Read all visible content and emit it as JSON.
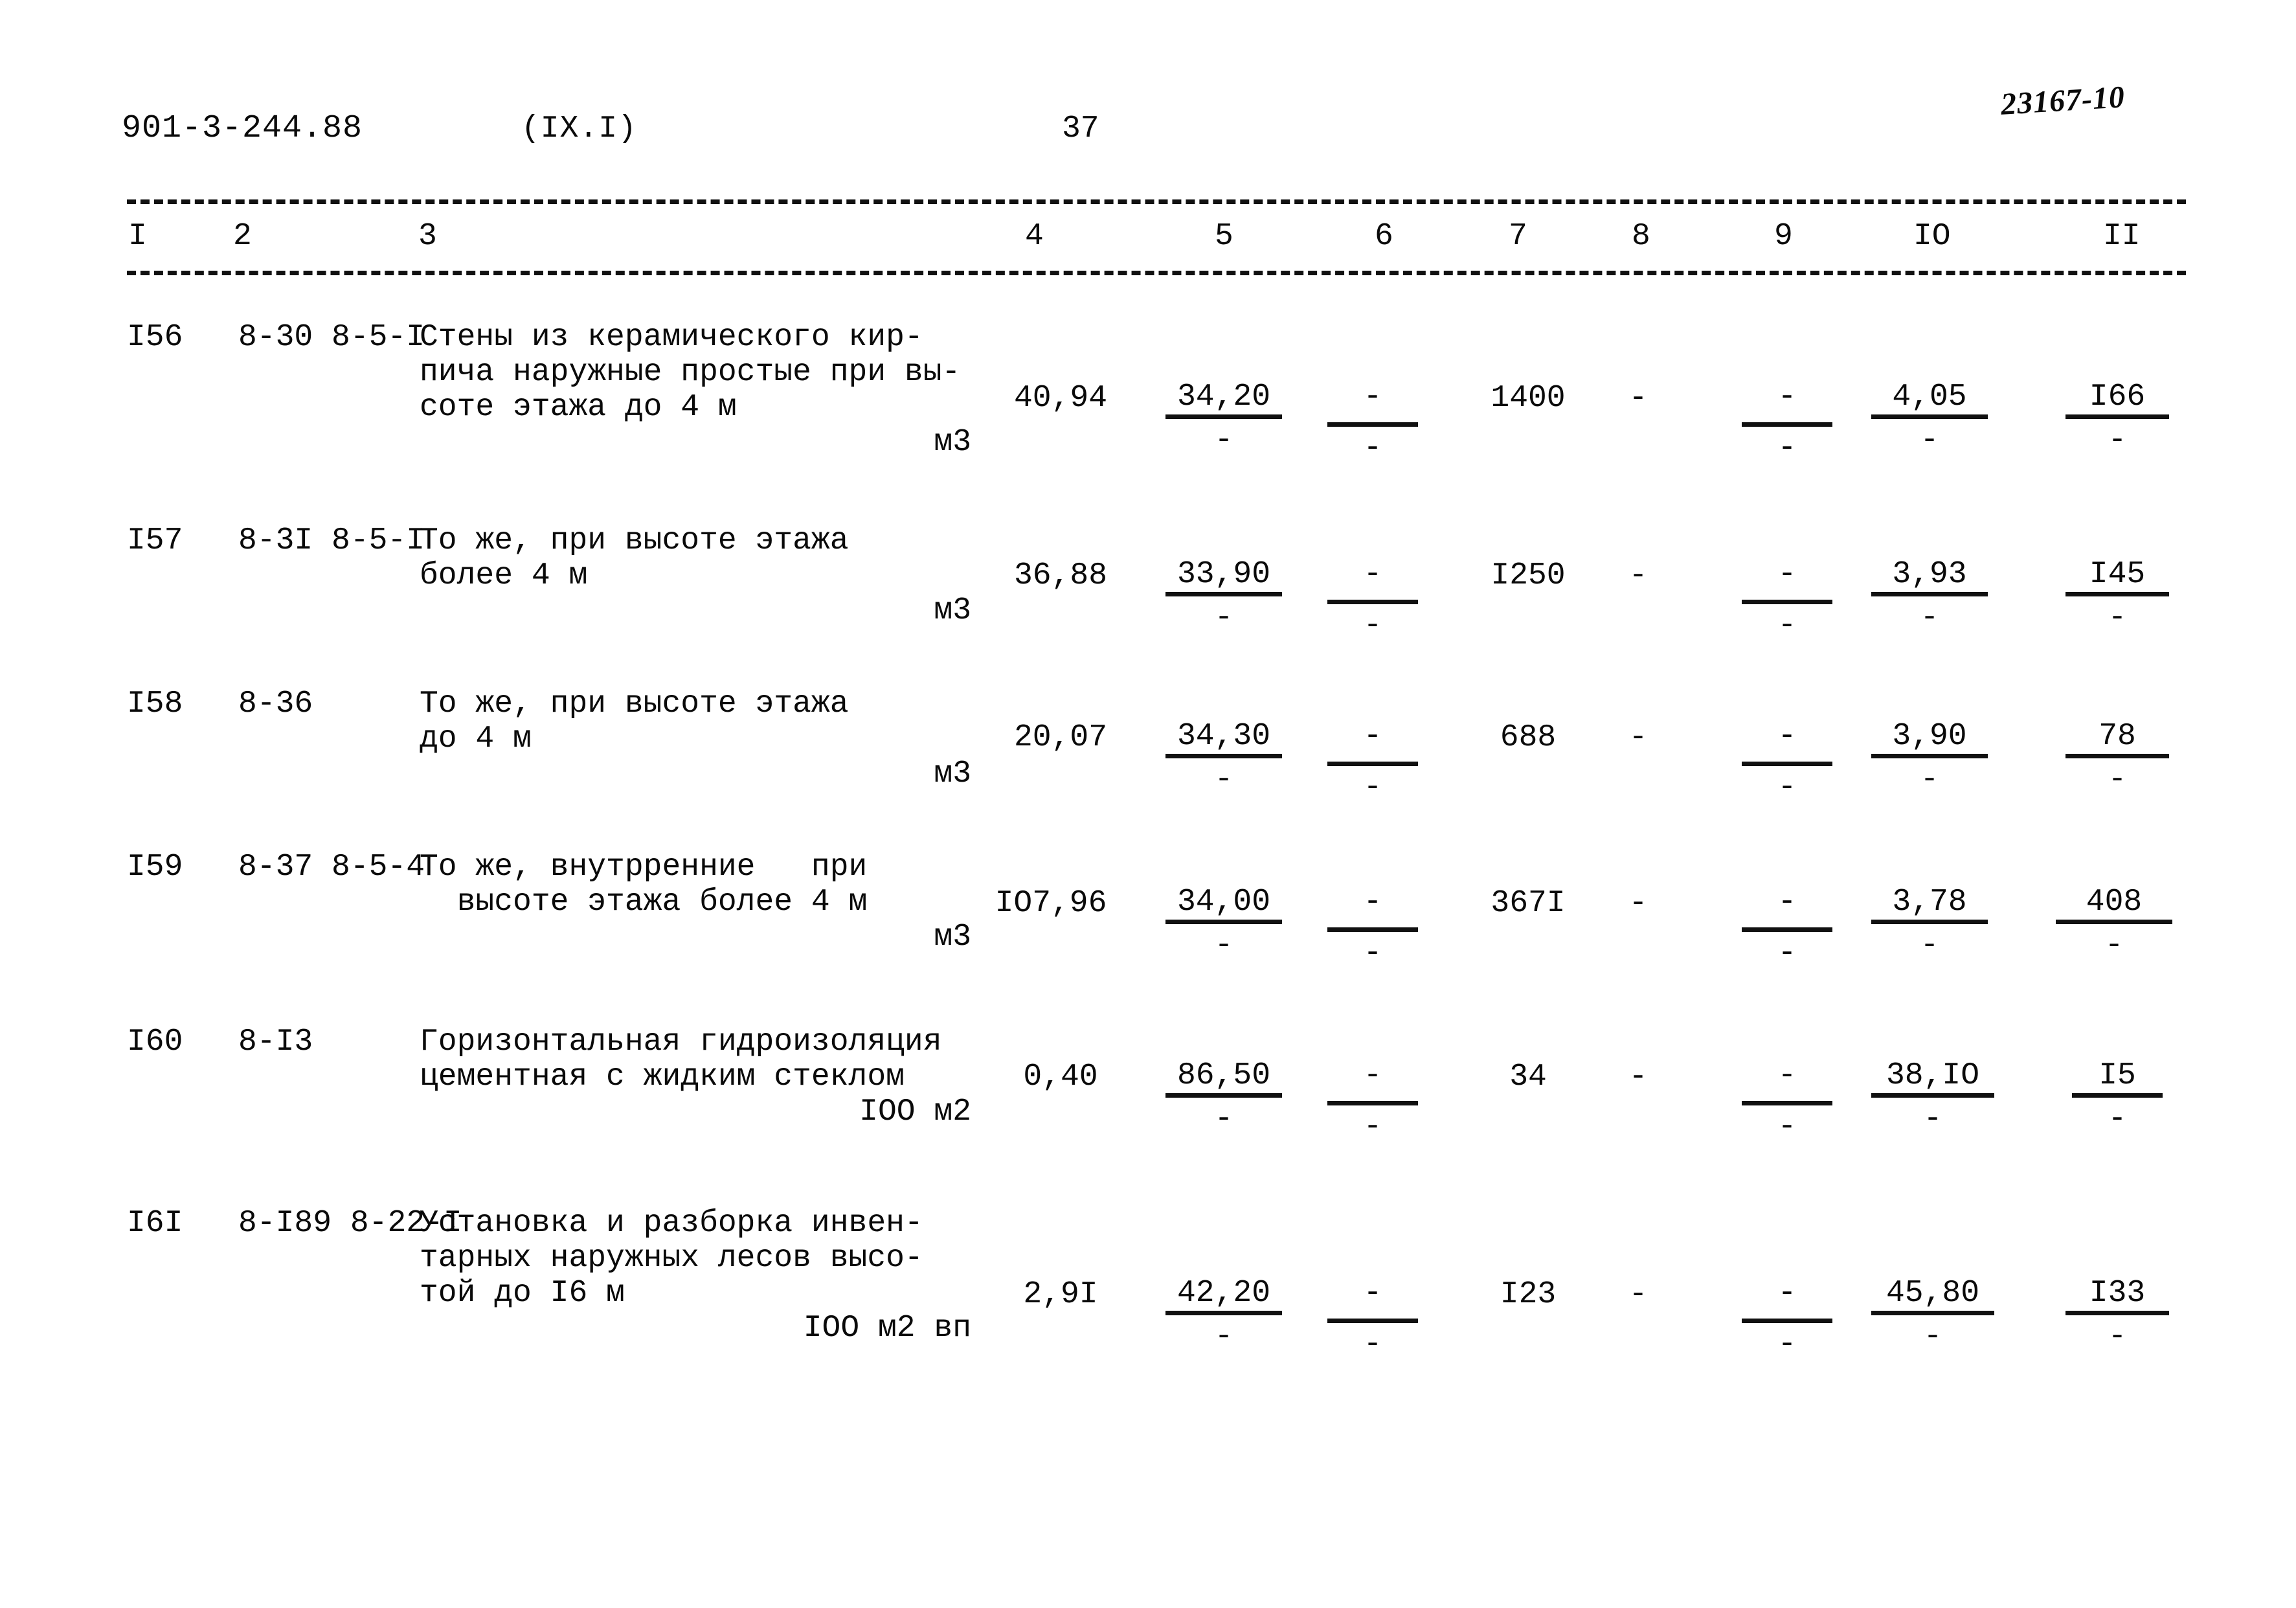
{
  "header": {
    "doc_code": "901-3-244.88",
    "section": "(IX.I)",
    "page_number": "37",
    "archive_mark": "23167-10"
  },
  "table": {
    "column_headers": [
      "I",
      "2",
      "3",
      "4",
      "5",
      "6",
      "7",
      "8",
      "9",
      "IO",
      "II"
    ],
    "rows": [
      {
        "num": "I56",
        "codes": "8-30\n8-5-I",
        "description": "Стены из керамического кир-\nпича наружные простые при вы-\nсоте этажа до 4 м",
        "unit": "м3",
        "c4": "40,94",
        "c5_num": "34,20",
        "c5_den": "-",
        "c6_num": "-",
        "c6_den": "-",
        "c7": "1400",
        "c8": "-",
        "c9_num": "-",
        "c9_den": "-",
        "c10_num": "4,05",
        "c10_den": "-",
        "c11_num": "I66",
        "c11_den": "-"
      },
      {
        "num": "I57",
        "codes": "8-3I\n8-5-I",
        "description": "То же, при высоте этажа\nболее 4 м",
        "unit": "м3",
        "c4": "36,88",
        "c5_num": "33,90",
        "c5_den": "-",
        "c6_num": "-",
        "c6_den": "-",
        "c7": "I250",
        "c8": "-",
        "c9_num": "-",
        "c9_den": "-",
        "c10_num": "3,93",
        "c10_den": "-",
        "c11_num": "I45",
        "c11_den": "-"
      },
      {
        "num": "I58",
        "codes": "8-36",
        "description": "То же, при высоте этажа\nдо 4 м",
        "unit": "м3",
        "c4": "20,07",
        "c5_num": "34,30",
        "c5_den": "-",
        "c6_num": "-",
        "c6_den": "-",
        "c7": "688",
        "c8": "-",
        "c9_num": "-",
        "c9_den": "-",
        "c10_num": "3,90",
        "c10_den": "-",
        "c11_num": "78",
        "c11_den": "-"
      },
      {
        "num": "I59",
        "codes": "8-37\n8-5-4",
        "description": "То же, внутрренние   при\n  высоте этажа более 4 м",
        "unit": "м3",
        "c4": "IO7,96",
        "c5_num": "34,00",
        "c5_den": "-",
        "c6_num": "-",
        "c6_den": "-",
        "c7": "367I",
        "c8": "-",
        "c9_num": "-",
        "c9_den": "-",
        "c10_num": "3,78",
        "c10_den": "-",
        "c11_num": "408",
        "c11_den": "-"
      },
      {
        "num": "I60",
        "codes": "8-I3",
        "description": "Горизонтальная гидроизоляция\nцементная с жидким стеклом",
        "unit": "IOO м2",
        "c4": "0,40",
        "c5_num": "86,50",
        "c5_den": "-",
        "c6_num": "-",
        "c6_den": "-",
        "c7": "34",
        "c8": "-",
        "c9_num": "-",
        "c9_den": "-",
        "c10_num": "38,IO",
        "c10_den": "-",
        "c11_num": "I5",
        "c11_den": "-"
      },
      {
        "num": "I6I",
        "codes": "8-I89\n8-22-I",
        "description": "Установка и разборка инвен-\nтарных наружных лесов высо-\nтой до I6 м",
        "unit": "IOO м2 вп",
        "c4": "2,9I",
        "c5_num": "42,20",
        "c5_den": "-",
        "c6_num": "-",
        "c6_den": "-",
        "c7": "I23",
        "c8": "-",
        "c9_num": "-",
        "c9_den": "-",
        "c10_num": "45,80",
        "c10_den": "-",
        "c11_num": "I33",
        "c11_den": "-"
      }
    ]
  }
}
